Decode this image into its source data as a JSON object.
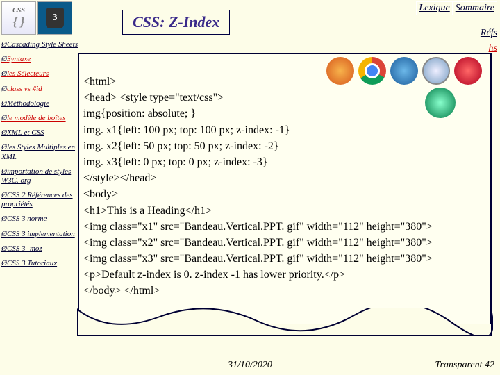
{
  "header": {
    "logo1_text": "CSS",
    "logo1_braces": "{ }",
    "logo2_text": "3",
    "title": "CSS: Z-Index"
  },
  "top_links": {
    "lexique": "Lexique",
    "sommaire": "Sommaire",
    "refs": "Réfs",
    "ths": "hs"
  },
  "sidebar": {
    "arrow": "Ø",
    "items": [
      {
        "label": "Cascading Style Sheets",
        "red": false
      },
      {
        "label": "Syntaxe",
        "red": true
      },
      {
        "label": "les Sélecteurs",
        "red": true
      },
      {
        "label": "class vs #id",
        "red": true
      },
      {
        "label": "Méthodologie",
        "red": false
      },
      {
        "label": "le modèle de boîtes",
        "red": true
      },
      {
        "label": "XML et CSS",
        "red": false
      },
      {
        "label": "les Styles Multiples en XML",
        "red": false
      },
      {
        "label": "importation de styles W3C. org",
        "red": false
      },
      {
        "label": "CSS 2 Références des propriétés",
        "red": false
      },
      {
        "label": "CSS 3 norme",
        "red": false
      },
      {
        "label": "CSS 3 implementation",
        "red": false
      },
      {
        "label": "CSS 3 -moz",
        "red": false
      },
      {
        "label": "CSS 3 Tutoriaux",
        "red": false
      }
    ]
  },
  "code_lines": {
    "l1": "<html>",
    "l2": "<head> <style type=\"text/css\">",
    "l3": "img{position: absolute; }",
    "l4": "img. x1{left: 100 px; top: 100 px; z-index: -1}",
    "l5": "img. x2{left: 50 px; top: 50 px; z-index: -2}",
    "l6": "img. x3{left: 0 px; top: 0 px; z-index: -3}",
    "l7": "</style></head>",
    "l8": "<body>",
    "l9": "<h1>This is a Heading</h1>",
    "l10": "<img class=\"x1\" src=\"Bandeau.Vertical.PPT. gif\" width=\"112\" height=\"380\">",
    "l11": "<img class=\"x2\" src=\"Bandeau.Vertical.PPT. gif\" width=\"112\" height=\"380\">",
    "l12": "<img class=\"x3\" src=\"Bandeau.Vertical.PPT. gif\" width=\"112\" height=\"380\">",
    "l13": "<p>Default z-index is 0. z-index -1 has lower priority.</p>",
    "l14": "</body> </html>"
  },
  "footer": {
    "date": "31/10/2020",
    "page": "Transparent 42"
  },
  "icons": {
    "ff": "firefox",
    "ch": "chrome",
    "ie": "ie",
    "sf": "safari",
    "op": "opera",
    "wheel": "ship-wheel"
  }
}
